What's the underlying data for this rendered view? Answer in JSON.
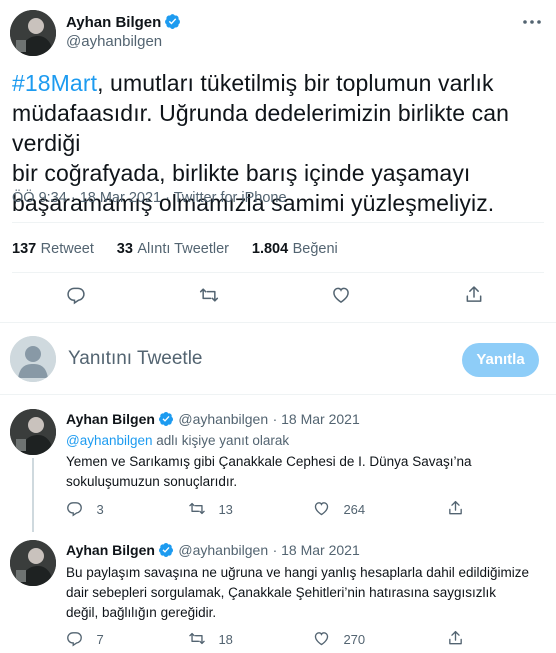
{
  "tweet": {
    "author_name": "Ayhan Bilgen",
    "author_handle": "@ayhanbilgen",
    "hashtag": "#18Mart",
    "text_line1_rest": ", umutları tüketilmiş bir toplumun varlık",
    "text_line2": "müdafaasıdır. Uğrunda dedelerimizin birlikte can verdiği",
    "text_line3": "bir coğrafyada, birlikte barış içinde yaşamayı",
    "text_line4": "başaramamış olmamızla samimi yüzleşmeliyiz.",
    "meta": "ÖÖ 9:34 · 18 Mar 2021 · Twitter for iPhone",
    "stats": {
      "retweets_count": "137",
      "retweets_label": "Retweet",
      "quotes_count": "33",
      "quotes_label": "Alıntı Tweetler",
      "likes_count": "1.804",
      "likes_label": "Beğeni"
    },
    "actions": [
      "reply-icon",
      "retweet-icon",
      "like-icon",
      "share-icon"
    ]
  },
  "composer": {
    "placeholder": "Yanıtını Tweetle",
    "button_label": "Yanıtla"
  },
  "replies": [
    {
      "author_name": "Ayhan Bilgen",
      "author_handle": "@ayhanbilgen",
      "date": "· 18 Mar 2021",
      "reply_to_handle": "@ayhanbilgen",
      "reply_to_suffix": " adlı kişiye yanıt olarak",
      "text_line1": "Yemen ve Sarıkamış gibi Çanakkale Cephesi de I. Dünya Savaşı’na",
      "text_line2": "sokuluşumuzun sonuçlarıdır.",
      "reply_count": "3",
      "retweet_count": "13",
      "like_count": "264"
    },
    {
      "author_name": "Ayhan Bilgen",
      "author_handle": "@ayhanbilgen",
      "date": "· 18 Mar 2021",
      "text_line1": "Bu paylaşım savaşına ne uğruna ve hangi yanlış hesaplarla dahil edildiğimize",
      "text_line2": "dair sebepleri sorgulamak, Çanakkale Şehitleri’nin hatırasına saygısızlık",
      "text_line3": "değil, bağlılığın gereğidir.",
      "reply_count": "7",
      "retweet_count": "18",
      "like_count": "270"
    }
  ],
  "colors": {
    "accent": "#1d9bf0",
    "button_disabled": "#8ecdf8",
    "secondary_text": "#536471",
    "divider": "#eff3f4"
  }
}
